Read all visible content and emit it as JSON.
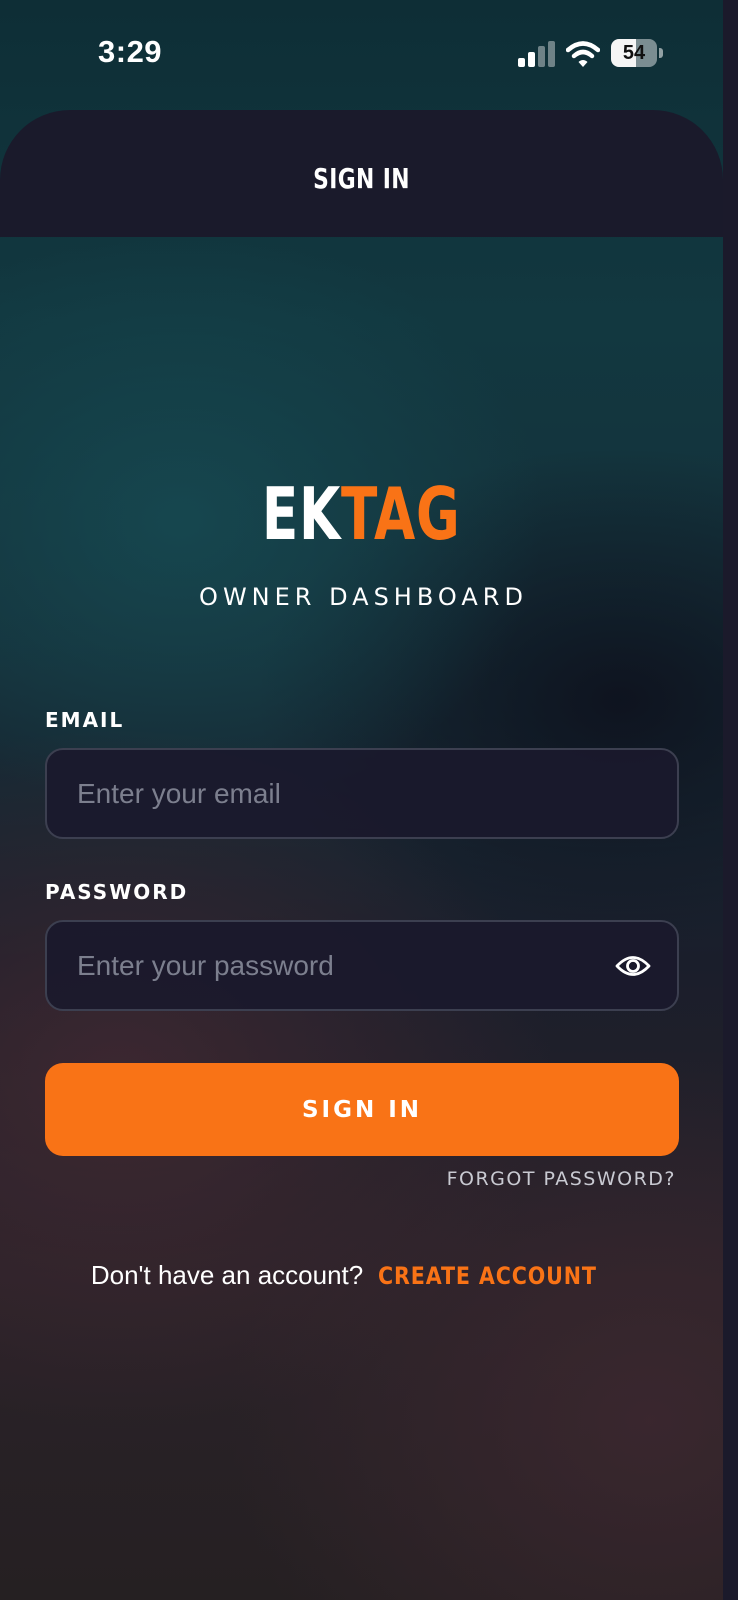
{
  "status_bar": {
    "time": "3:29",
    "battery_percent": "54",
    "signal_icon": "cellular-signal-icon",
    "wifi_icon": "wifi-icon"
  },
  "header": {
    "title": "SIGN IN"
  },
  "logo": {
    "part1": "EK",
    "part2": "TAG"
  },
  "subtitle": "OWNER DASHBOARD",
  "form": {
    "email_label": "EMAIL",
    "email_placeholder": "Enter your email",
    "email_value": "",
    "password_label": "PASSWORD",
    "password_placeholder": "Enter your password",
    "password_value": "",
    "password_visibility_icon": "eye-icon",
    "submit_label": "SIGN IN",
    "forgot_label": "FORGOT PASSWORD?"
  },
  "footer": {
    "prompt": "Don't have an account?",
    "create_label": "CREATE ACCOUNT"
  },
  "colors": {
    "accent": "#f97316",
    "header_bg": "#1a1a2b",
    "input_bg": "#1a192c",
    "input_border": "#3c3f50"
  }
}
